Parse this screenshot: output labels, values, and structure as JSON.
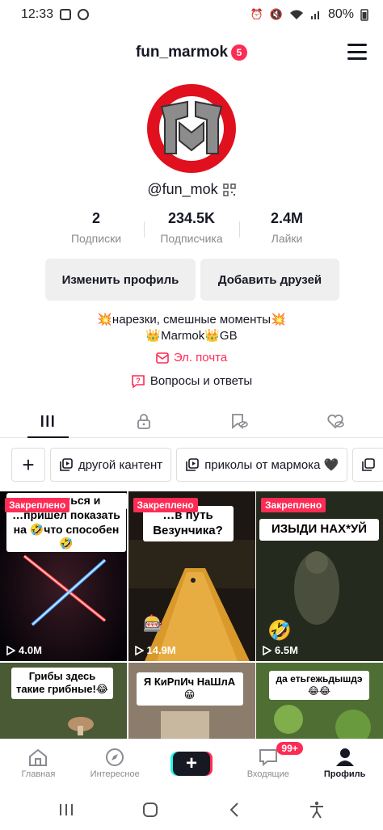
{
  "status_bar": {
    "time": "12:33",
    "battery": "80%"
  },
  "profile": {
    "username": "fun_marmok",
    "notifications": "5",
    "handle": "@fun_mok",
    "stats": [
      {
        "value": "2",
        "label": "Подписки"
      },
      {
        "value": "234.5K",
        "label": "Подписчика"
      },
      {
        "value": "2.4M",
        "label": "Лайки"
      }
    ],
    "edit_label": "Изменить профиль",
    "add_friends_label": "Добавить друзей",
    "bio_line1": "💥нарезки, смешные моменты💥",
    "bio_line2": "👑Marmok👑GB",
    "email_label": "Эл. почта",
    "qa_label": "Вопросы и ответы"
  },
  "playlists": [
    "другой кантент",
    "приколы от мармока 🖤"
  ],
  "videos": [
    {
      "pinned": "Закреплено",
      "views": "4.0M",
      "caption": "…пришёл показать на 🤣что способен🤣",
      "caption_top": "…оваться и"
    },
    {
      "pinned": "Закреплено",
      "views": "14.9M",
      "caption": "…в путь Везунчика?"
    },
    {
      "pinned": "Закреплено",
      "views": "6.5M",
      "caption": "ИЗЫДИ НАХ*УЙ"
    },
    {
      "caption": "Грибы здесь такие грибные!😂"
    },
    {
      "caption": "Я КиРпИч НаШлА😁"
    },
    {
      "caption": "да етьгежьдышдэ😂😂"
    }
  ],
  "bottom_nav": [
    {
      "label": "Главная"
    },
    {
      "label": "Интересное"
    },
    {
      "label": ""
    },
    {
      "label": "Входящие",
      "badge": "99+"
    },
    {
      "label": "Профиль"
    }
  ],
  "colors": {
    "accent": "#fe2c55",
    "avatar_bg": "#e0101e"
  }
}
